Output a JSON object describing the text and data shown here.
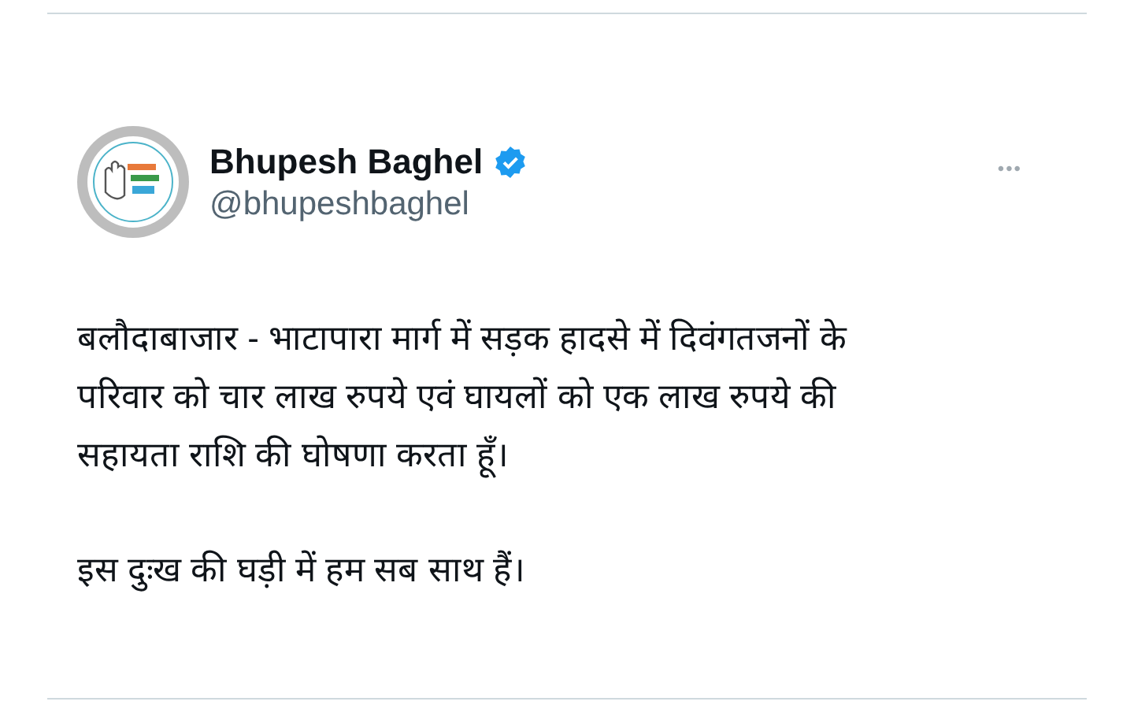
{
  "tweet": {
    "author": {
      "name": "Bhupesh Baghel",
      "verified": true,
      "handle": "@bhupeshbaghel"
    },
    "more_button": "•••",
    "paragraphs": [
      {
        "lines": [
          "बलौदाबाजार - भाटापारा मार्ग में सड़क हादसे में दिवंगतजनों के",
          "परिवार को चार लाख रुपये एवं घायलों को एक लाख रुपये की",
          "सहायता राशि की घोषणा करता हूँ।"
        ]
      },
      {
        "lines": [
          "इस दुःख की घड़ी में हम सब साथ हैं।"
        ]
      }
    ]
  }
}
